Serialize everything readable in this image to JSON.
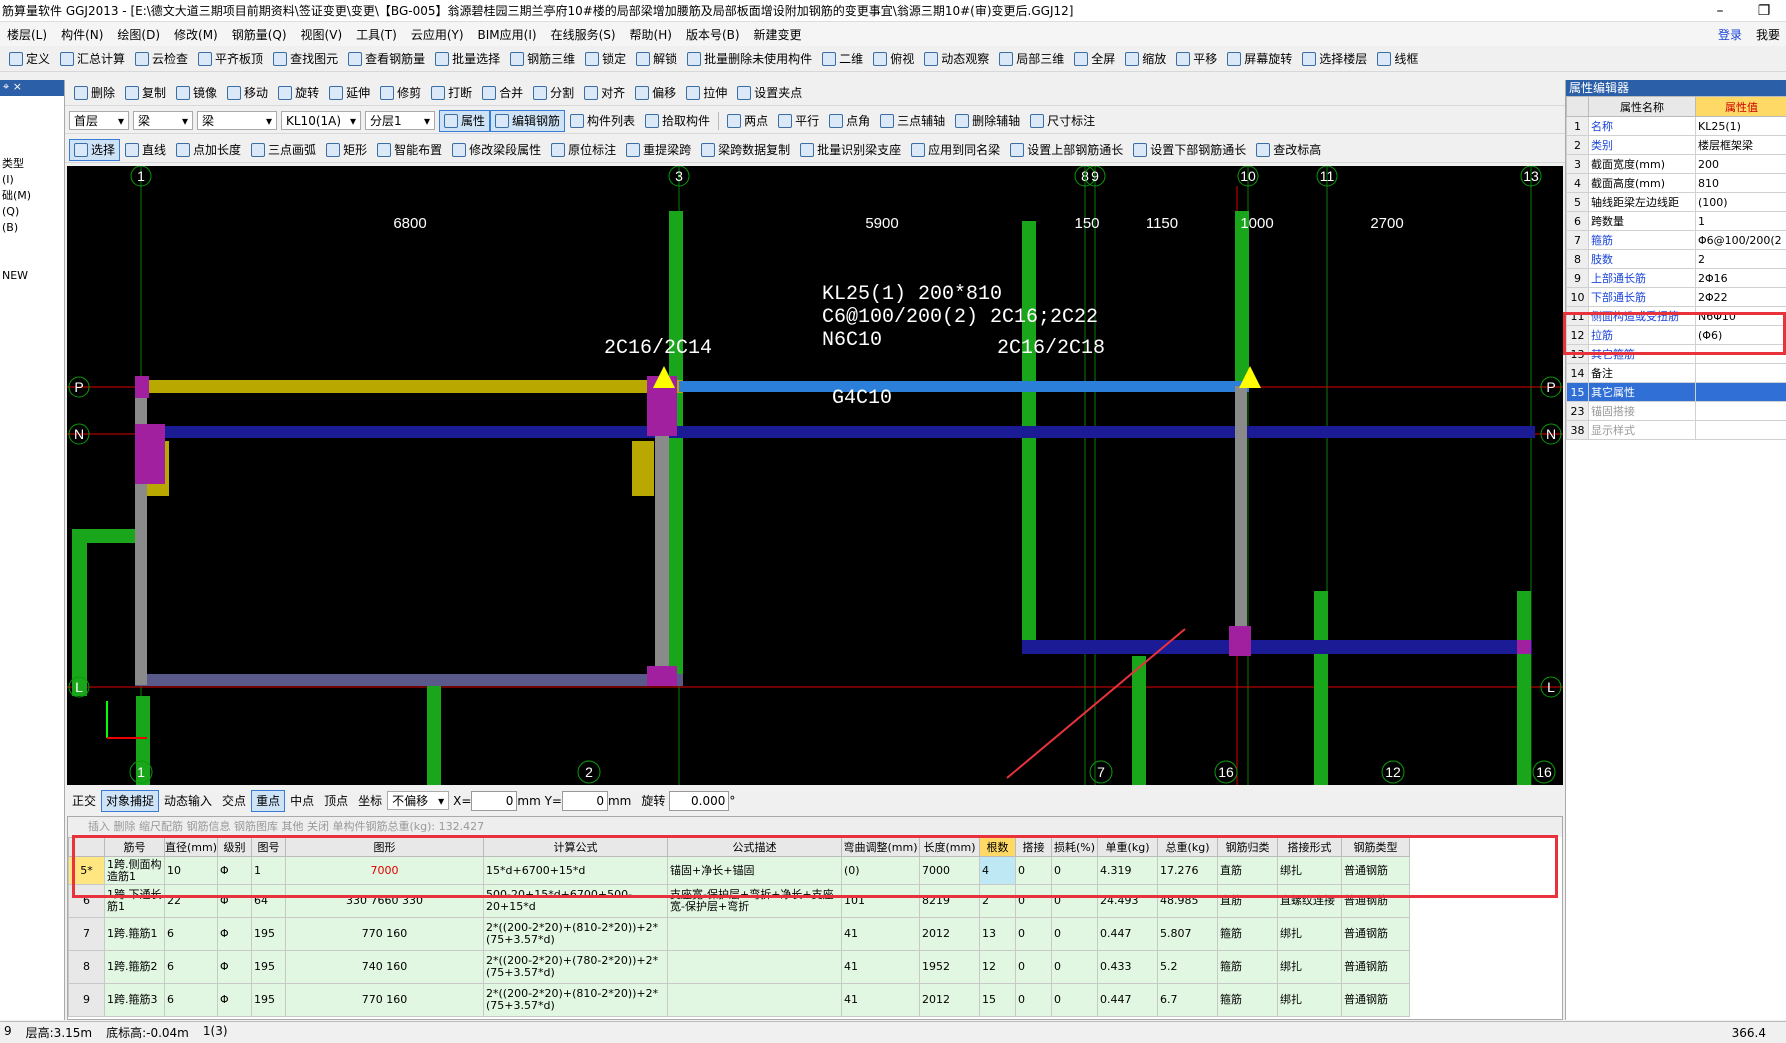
{
  "window": {
    "title": "筋算量软件 GGJ2013 - [E:\\德文大道三期项目前期资料\\签证变更\\变更\\【BG-005】翁源碧桂园三期兰亭府10#楼的局部梁增加腰筋及局部板面增设附加钢筋的变更事宜\\翁源三期10#(审)变更后.GGJ12]"
  },
  "menu": {
    "items": [
      "楼层(L)",
      "构件(N)",
      "绘图(D)",
      "修改(M)",
      "钢筋量(Q)",
      "视图(V)",
      "工具(T)",
      "云应用(Y)",
      "BIM应用(I)",
      "在线服务(S)",
      "帮助(H)",
      "版本号(B)",
      "新建变更"
    ],
    "login": "登录",
    "me": "我要"
  },
  "toolbar1": [
    "定义",
    "汇总计算",
    "云检查",
    "平齐板顶",
    "查找图元",
    "查看钢筋量",
    "批量选择",
    "钢筋三维",
    "锁定",
    "解锁",
    "批量删除未使用构件",
    "二维",
    "俯视",
    "动态观察",
    "局部三维",
    "全屏",
    "缩放",
    "平移",
    "屏幕旋转",
    "选择楼层",
    "线框"
  ],
  "toolbar2": [
    "删除",
    "复制",
    "镜像",
    "移动",
    "旋转",
    "延伸",
    "修剪",
    "打断",
    "合并",
    "分割",
    "对齐",
    "偏移",
    "拉伸",
    "设置夹点"
  ],
  "toolbar3": {
    "floor": "首层",
    "type1": "梁",
    "type2": "梁",
    "member": "KL10(1A)",
    "layer": "分层1",
    "buttons": [
      "属性",
      "编辑钢筋",
      "构件列表",
      "拾取构件"
    ],
    "right": [
      "两点",
      "平行",
      "点角",
      "三点辅轴",
      "删除辅轴",
      "尺寸标注"
    ]
  },
  "toolbar4": [
    "选择",
    "直线",
    "点加长度",
    "三点画弧",
    "矩形",
    "智能布置",
    "修改梁段属性",
    "原位标注",
    "重提梁跨",
    "梁跨数据复制",
    "批量识别梁支座",
    "应用到同名梁",
    "设置上部钢筋通长",
    "设置下部钢筋通长",
    "查改标高"
  ],
  "left_panel": {
    "items": [
      "类型",
      "(I)",
      "础(M)",
      "(Q)",
      "(B)",
      "",
      "",
      "NEW"
    ]
  },
  "canvas": {
    "axis_top": [
      "1",
      "3",
      "8",
      "9",
      "10",
      "11",
      "13"
    ],
    "axis_bottom": [
      "1",
      "2",
      "7",
      "16",
      "12",
      "16"
    ],
    "axis_side": [
      "P",
      "N",
      "L"
    ],
    "dims": [
      "6800",
      "5900",
      "150",
      "1150",
      "1000",
      "2700"
    ],
    "beam_labels": [
      "KL25(1) 200*810",
      "C6@100/200(2) 2C16;2C22",
      "N6C10",
      "2C16/2C14",
      "2C16/2C18",
      "G4C10"
    ]
  },
  "snapbar": {
    "items": [
      "正交",
      "对象捕捉",
      "动态输入",
      "交点",
      "重点",
      "中点",
      "顶点",
      "坐标"
    ],
    "offset_mode": "不偏移",
    "x_label": "X=",
    "x_val": "0",
    "y_label": "mm Y=",
    "y_val": "0",
    "unit": "mm",
    "rotate_label": "旋转",
    "rotate_val": "0.000",
    "deg": "°"
  },
  "rebar_grid": {
    "toolbar": "插入  删除  缩尺配筋  钢筋信息  钢筋图库  其他  关闭  单构件钢筋总重(kg): 132.427",
    "headers": [
      "",
      "筋号",
      "直径(mm)",
      "级别",
      "图号",
      "图形",
      "计算公式",
      "公式描述",
      "弯曲调整(mm)",
      "长度(mm)",
      "根数",
      "搭接",
      "损耗(%)",
      "单重(kg)",
      "总重(kg)",
      "钢筋归类",
      "搭接形式",
      "钢筋类型"
    ],
    "rows": [
      {
        "rn": "5*",
        "name": "1跨.侧面构造筋1",
        "dia": "10",
        "grade": "Φ",
        "fig": "1",
        "shape": "7000",
        "formula": "15*d+6700+15*d",
        "desc": "锚固+净长+锚固",
        "bend": "(0)",
        "len": "7000",
        "count": "4",
        "lap": "0",
        "loss": "0",
        "unit": "4.319",
        "total": "17.276",
        "cls": "直筋",
        "lapform": "绑扎",
        "type": "普通钢筋"
      },
      {
        "rn": "6",
        "name": "1跨.下通长筋1",
        "dia": "22",
        "grade": "Φ",
        "fig": "64",
        "shape": "330 7660 330",
        "formula": "500-20+15*d+6700+500-20+15*d",
        "desc": "支座宽-保护层+弯折+净长+支座宽-保护层+弯折",
        "bend": "101",
        "len": "8219",
        "count": "2",
        "lap": "0",
        "loss": "0",
        "unit": "24.493",
        "total": "48.985",
        "cls": "直筋",
        "lapform": "直螺纹连接",
        "type": "普通钢筋"
      },
      {
        "rn": "7",
        "name": "1跨.箍筋1",
        "dia": "6",
        "grade": "Φ",
        "fig": "195",
        "shape": "770 160",
        "formula": "2*((200-2*20)+(810-2*20))+2*(75+3.57*d)",
        "desc": "",
        "bend": "41",
        "len": "2012",
        "count": "13",
        "lap": "0",
        "loss": "0",
        "unit": "0.447",
        "total": "5.807",
        "cls": "箍筋",
        "lapform": "绑扎",
        "type": "普通钢筋"
      },
      {
        "rn": "8",
        "name": "1跨.箍筋2",
        "dia": "6",
        "grade": "Φ",
        "fig": "195",
        "shape": "740 160",
        "formula": "2*((200-2*20)+(780-2*20))+2*(75+3.57*d)",
        "desc": "",
        "bend": "41",
        "len": "1952",
        "count": "12",
        "lap": "0",
        "loss": "0",
        "unit": "0.433",
        "total": "5.2",
        "cls": "箍筋",
        "lapform": "绑扎",
        "type": "普通钢筋"
      },
      {
        "rn": "9",
        "name": "1跨.箍筋3",
        "dia": "6",
        "grade": "Φ",
        "fig": "195",
        "shape": "770 160",
        "formula": "2*((200-2*20)+(810-2*20))+2*(75+3.57*d)",
        "desc": "",
        "bend": "41",
        "len": "2012",
        "count": "15",
        "lap": "0",
        "loss": "0",
        "unit": "0.447",
        "total": "6.7",
        "cls": "箍筋",
        "lapform": "绑扎",
        "type": "普通钢筋"
      }
    ]
  },
  "properties": {
    "title": "属性编辑器",
    "col_name": "属性名称",
    "col_value": "属性值",
    "rows": [
      {
        "n": "1",
        "name": "名称",
        "val": "KL25(1)",
        "style": "blue"
      },
      {
        "n": "2",
        "name": "类别",
        "val": "楼层框架梁",
        "style": "blue"
      },
      {
        "n": "3",
        "name": "截面宽度(mm)",
        "val": "200",
        "style": ""
      },
      {
        "n": "4",
        "name": "截面高度(mm)",
        "val": "810",
        "style": ""
      },
      {
        "n": "5",
        "name": "轴线距梁左边线距",
        "val": "(100)",
        "style": ""
      },
      {
        "n": "6",
        "name": "跨数量",
        "val": "1",
        "style": ""
      },
      {
        "n": "7",
        "name": "箍筋",
        "val": "Φ6@100/200(2",
        "style": "blue"
      },
      {
        "n": "8",
        "name": "肢数",
        "val": "2",
        "style": "blue"
      },
      {
        "n": "9",
        "name": "上部通长筋",
        "val": "2Φ16",
        "style": "blue"
      },
      {
        "n": "10",
        "name": "下部通长筋",
        "val": "2Φ22",
        "style": "blue"
      },
      {
        "n": "11",
        "name": "侧面构造或受扭筋",
        "val": "N6Φ10",
        "style": "blue"
      },
      {
        "n": "12",
        "name": "拉筋",
        "val": "(Φ6)",
        "style": "blue"
      },
      {
        "n": "13",
        "name": "其它箍筋",
        "val": "",
        "style": "blue"
      },
      {
        "n": "14",
        "name": "备注",
        "val": "",
        "style": ""
      },
      {
        "n": "15",
        "name": "其它属性",
        "val": "",
        "style": "sel"
      },
      {
        "n": "23",
        "name": "锚固搭接",
        "val": "",
        "style": "gray"
      },
      {
        "n": "38",
        "name": "显示样式",
        "val": "",
        "style": "gray"
      }
    ]
  },
  "status": {
    "items": [
      "9",
      "层高:3.15m",
      "底标高:-0.04m",
      "1(3)"
    ],
    "right": "366.4"
  }
}
